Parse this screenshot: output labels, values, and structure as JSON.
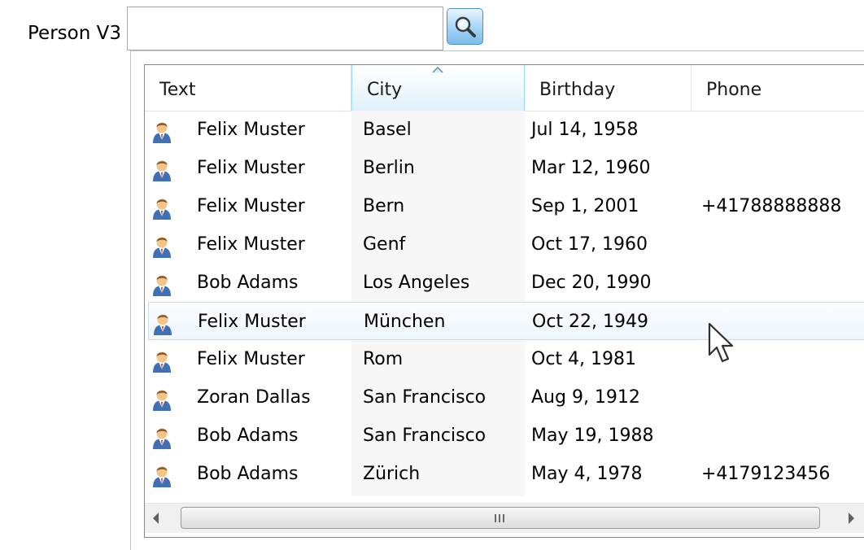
{
  "field": {
    "label": "Person V3",
    "value": "",
    "placeholder": ""
  },
  "columns": [
    {
      "label": "Text"
    },
    {
      "label": "City",
      "sort": "ascending"
    },
    {
      "label": "Birthday"
    },
    {
      "label": "Phone"
    }
  ],
  "rows": [
    {
      "text": "Felix Muster",
      "city": "Basel",
      "birthday": "Jul 14, 1958",
      "phone": ""
    },
    {
      "text": "Felix Muster",
      "city": "Berlin",
      "birthday": "Mar 12, 1960",
      "phone": ""
    },
    {
      "text": "Felix Muster",
      "city": "Bern",
      "birthday": "Sep 1, 2001",
      "phone": "+41788888888"
    },
    {
      "text": "Felix Muster",
      "city": "Genf",
      "birthday": "Oct 17, 1960",
      "phone": ""
    },
    {
      "text": "Bob Adams",
      "city": "Los Angeles",
      "birthday": "Dec 20, 1990",
      "phone": ""
    },
    {
      "text": "Felix Muster",
      "city": "München",
      "birthday": "Oct 22, 1949",
      "phone": ""
    },
    {
      "text": "Felix Muster",
      "city": "Rom",
      "birthday": "Oct 4, 1981",
      "phone": ""
    },
    {
      "text": "Zoran Dallas",
      "city": "San Francisco",
      "birthday": "Aug 9, 1912",
      "phone": ""
    },
    {
      "text": "Bob Adams",
      "city": "San Francisco",
      "birthday": "May 19, 1988",
      "phone": ""
    },
    {
      "text": "Bob Adams",
      "city": "Zürich",
      "birthday": "May 4, 1978",
      "phone": "+4179123456"
    }
  ],
  "hovered_row": 5,
  "icons": {
    "row": "person-icon",
    "search": "magnifier-icon"
  },
  "colors": {
    "accent": "#96d9f9",
    "hover": "#eef6fd",
    "search_button": "#9fd1f6"
  }
}
